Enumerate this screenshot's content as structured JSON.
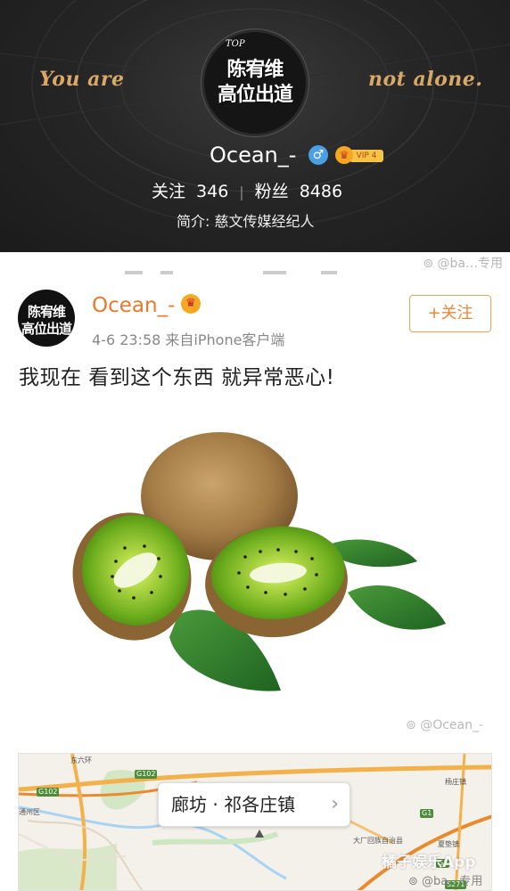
{
  "profile": {
    "slogan_left": "You are",
    "slogan_right": "not alone.",
    "logo_top": "TOP",
    "logo_line1": "陈宥维",
    "logo_line2": "高位出道",
    "name": "Ocean_-",
    "gender_symbol": "♂",
    "vip_label": "VIP 4",
    "following_label": "关注",
    "following_count": "346",
    "fans_label": "粉丝",
    "fans_count": "8486",
    "bio": "简介: 慈文传媒经纪人"
  },
  "watermarks": {
    "top": "@ba…专用",
    "image": "@Ocean_-",
    "map_brand": "橘子娱乐App",
    "map_bottom": "@ba…专用"
  },
  "post": {
    "avatar_line1": "陈宥维",
    "avatar_line2": "高位出道",
    "author": "Ocean_-",
    "time_source": "4-6 23:58  来自iPhone客户端",
    "follow_label": "+关注",
    "text": "我现在 看到这个东西 就异常恶心!",
    "image_subject": "kiwi-fruit-photo"
  },
  "map": {
    "location": "廊坊 · 祁各庄镇",
    "chevron": "›",
    "labels": [
      "东六环",
      "G102",
      "G102",
      "通州区",
      "大厂回族自治县",
      "夏垫镇",
      "G1",
      "G1",
      "杨庄镇",
      "S271"
    ],
    "colors": {
      "road": "#f2b14a",
      "highway": "#e98b2d",
      "water": "#a9d3f2",
      "green": "#cfe6c2"
    }
  },
  "colors": {
    "accent_orange": "#e6792e",
    "gold": "#d7a868",
    "banner_bg": "#232323"
  }
}
